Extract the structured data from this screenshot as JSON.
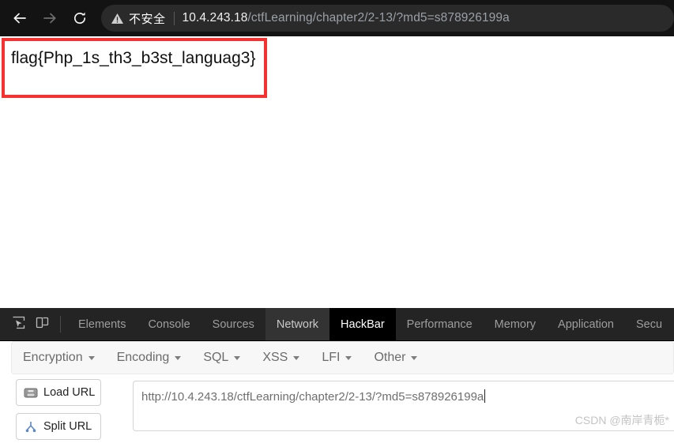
{
  "browser": {
    "nav": {
      "back_label": "Back",
      "forward_label": "Forward",
      "reload_label": "Reload"
    },
    "omnibox": {
      "security_icon": "warning-triangle-icon",
      "security_label": "不安全",
      "url_host": "10.4.243.18",
      "url_path": "/ctfLearning/chapter2/2-13/?md5=s878926199a",
      "full_url": "10.4.243.18/ctfLearning/chapter2/2-13/?md5=s878926199a"
    },
    "colors": {
      "toolbar_bg": "#131313",
      "omnibox_bg": "#2a2a2a",
      "host_text": "#f1f1f1",
      "path_text": "#9aa0a6"
    }
  },
  "page": {
    "flag_text": "flag{Php_1s_th3_b3st_languag3}",
    "annotation_border_color": "#f7312f"
  },
  "devtools": {
    "toolbar_icons": [
      {
        "name": "inspect-element-icon"
      },
      {
        "name": "device-toolbar-icon"
      }
    ],
    "tabs": [
      {
        "label": "Elements",
        "state": "normal"
      },
      {
        "label": "Console",
        "state": "normal"
      },
      {
        "label": "Sources",
        "state": "normal"
      },
      {
        "label": "Network",
        "state": "hover"
      },
      {
        "label": "HackBar",
        "state": "active"
      },
      {
        "label": "Performance",
        "state": "normal"
      },
      {
        "label": "Memory",
        "state": "normal"
      },
      {
        "label": "Application",
        "state": "normal"
      },
      {
        "label": "Secu",
        "state": "clipped"
      }
    ],
    "active_tab": "HackBar",
    "colors": {
      "tabbar_bg": "#242424",
      "active_tab_bg": "#000000",
      "tab_text": "#9e9e9e"
    }
  },
  "hackbar": {
    "menu": [
      {
        "label": "Encryption",
        "icon": "chevron-down-icon"
      },
      {
        "label": "Encoding",
        "icon": "chevron-down-icon"
      },
      {
        "label": "SQL",
        "icon": "chevron-down-icon"
      },
      {
        "label": "XSS",
        "icon": "chevron-down-icon"
      },
      {
        "label": "LFI",
        "icon": "chevron-down-icon"
      },
      {
        "label": "Other",
        "icon": "chevron-down-icon"
      }
    ],
    "buttons": [
      {
        "label": "Load URL",
        "icon": "load-url-icon"
      },
      {
        "label": "Split URL",
        "icon": "split-url-icon"
      }
    ],
    "url_field": {
      "value": "http://10.4.243.18/ctfLearning/chapter2/2-13/?md5=s878926199a",
      "placeholder": "",
      "focused": true
    }
  },
  "watermark": {
    "text": "CSDN @南岸青栀*"
  }
}
